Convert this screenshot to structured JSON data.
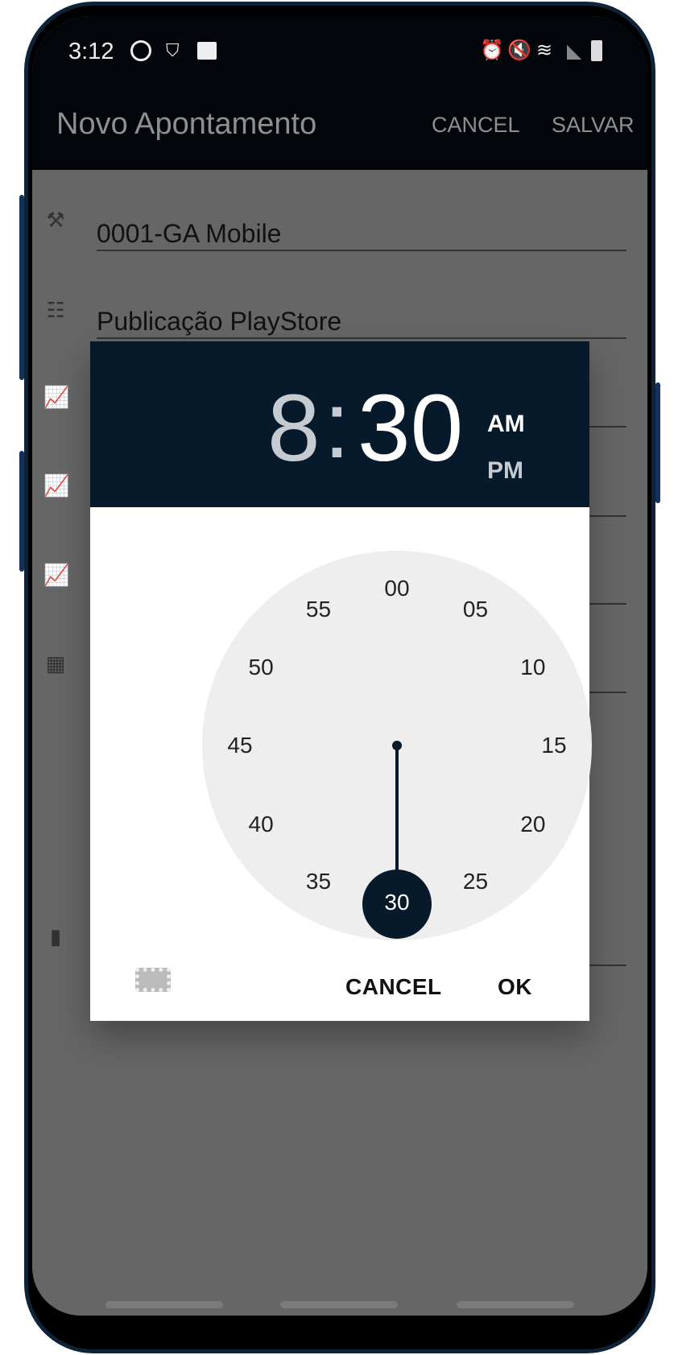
{
  "status_bar": {
    "time": "3:12",
    "left_icons": [
      "whatsapp-icon",
      "shield-check-icon",
      "image-icon"
    ],
    "right_icons": [
      "alarm-icon",
      "mute-icon",
      "wifi-icon",
      "signal-icon",
      "battery-icon"
    ]
  },
  "app_bar": {
    "title": "Novo Apontamento",
    "cancel_label": "CANCEL",
    "save_label": "SALVAR"
  },
  "form": {
    "fields": [
      {
        "icon": "hammer-icon",
        "value": "0001-GA Mobile"
      },
      {
        "icon": "hierarchy-icon",
        "value": "Publicação PlayStore"
      },
      {
        "icon": "chart-icon",
        "value": ""
      },
      {
        "icon": "chart-icon",
        "value": ""
      },
      {
        "icon": "chart-icon",
        "value": ""
      },
      {
        "icon": "calendar-icon",
        "value": ""
      },
      {
        "icon": "clipboard-icon",
        "value": ""
      }
    ]
  },
  "time_picker": {
    "hour": "8",
    "separator": ":",
    "minute": "30",
    "am_label": "AM",
    "pm_label": "PM",
    "selected_period": "AM",
    "dial_numbers": [
      "00",
      "05",
      "10",
      "15",
      "20",
      "25",
      "30",
      "35",
      "40",
      "45",
      "50",
      "55"
    ],
    "selected_minute": "30",
    "cancel_label": "CANCEL",
    "ok_label": "OK",
    "keyboard_icon": "keyboard-icon",
    "colors": {
      "header": "#061a2b",
      "dial": "#eeeeee",
      "selector": "#061a2b"
    }
  }
}
